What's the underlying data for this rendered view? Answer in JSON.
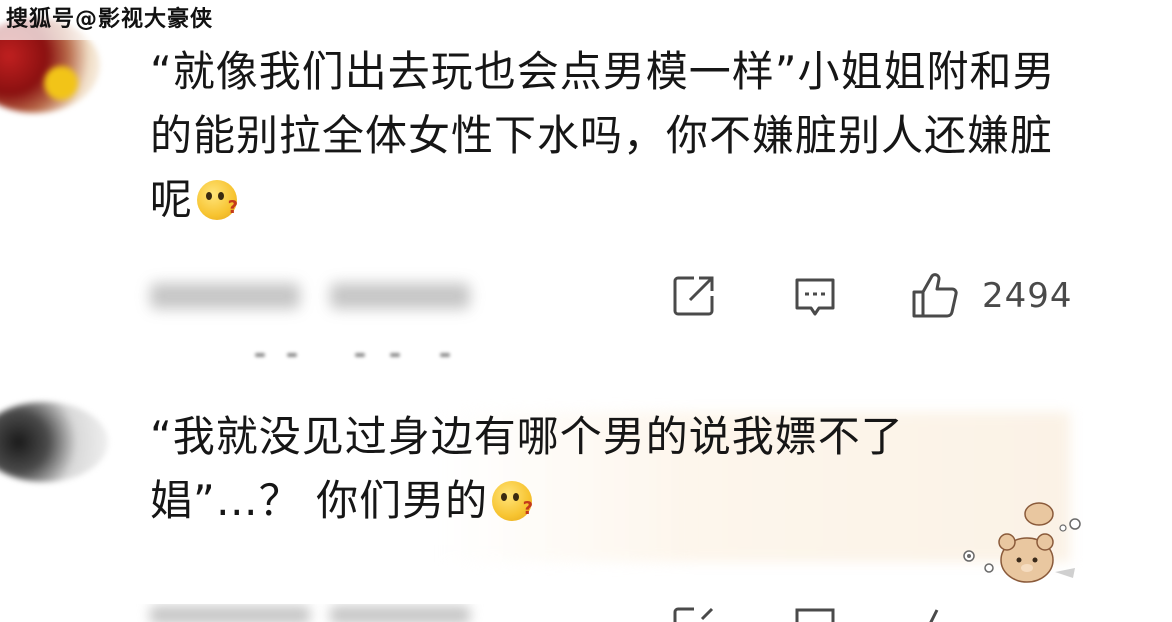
{
  "watermark": "搜狐号@影视大豪侠",
  "comments": [
    {
      "text": "“就像我们出去玩也会点男模一样”小姐姐附和男的能别拉全体女性下水吗，你不嫌脏别人还嫌脏呢",
      "emoji": "thinking-face-emoji",
      "likes": "2494",
      "icons": [
        "share-icon",
        "comment-icon",
        "like-icon"
      ]
    },
    {
      "text": "“我就没见过身边有哪个男的说我嫖不了娼”…？ 你们男的",
      "emoji": "thinking-face-emoji"
    }
  ],
  "colors": {
    "text": "#161616",
    "icon": "#4a4a4a",
    "highlight": "#fbf2e6",
    "emoji": "#f7c431"
  }
}
